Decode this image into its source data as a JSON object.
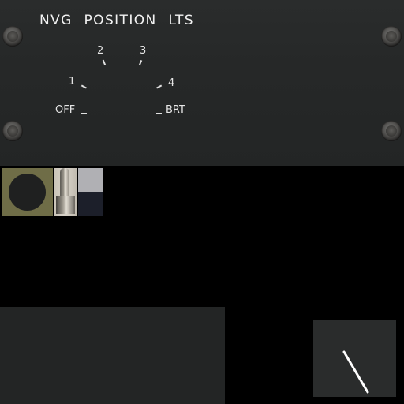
{
  "panel": {
    "title": "NVG POSITION LTS",
    "knob_positions": [
      "OFF",
      "1",
      "2",
      "3",
      "4",
      "BRT"
    ]
  },
  "icons": {
    "screws": "screw-icon",
    "knob": "rotary-knob-texture",
    "toggle": "toggle-switch-texture",
    "line": "indicator-line"
  },
  "colors": {
    "panel": "#262828",
    "label": "#f2f2f2",
    "knob_base": "#6f6d47",
    "swatch_light": "#b0b0b4",
    "swatch_dark": "#1c1f2a"
  }
}
